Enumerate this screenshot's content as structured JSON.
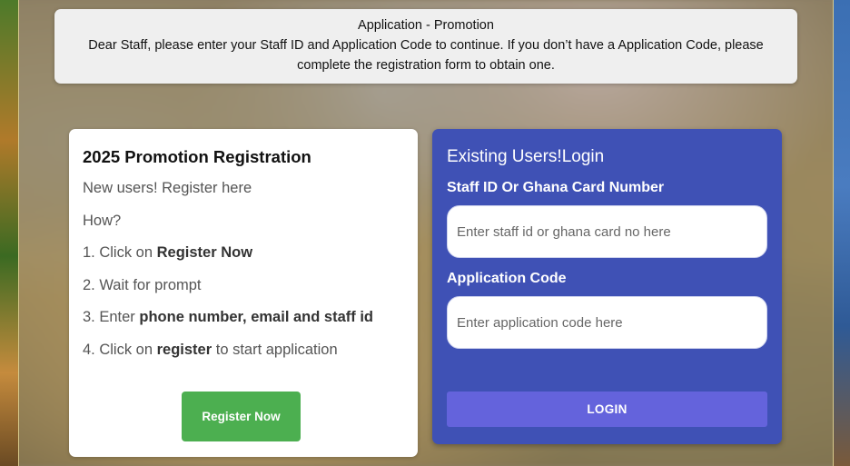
{
  "banner": {
    "title": "Application - Promotion",
    "message": "Dear Staff, please enter your Staff ID and Application Code to continue. If you don’t have a Application Code, please complete the registration form to obtain one."
  },
  "register": {
    "heading": "2025 Promotion Registration",
    "intro": "New users! Register here",
    "how": "How?",
    "steps": [
      {
        "before": "1. Click on ",
        "bold": "Register Now",
        "after": ""
      },
      {
        "before": "2. Wait for prompt",
        "bold": "",
        "after": ""
      },
      {
        "before": "3. Enter ",
        "bold": "phone number, email and staff id",
        "after": ""
      },
      {
        "before": "4. Click on ",
        "bold": "register",
        "after": " to start application"
      }
    ],
    "button_label": "Register Now"
  },
  "login": {
    "heading": "Existing Users!Login",
    "staff_label": "Staff ID Or Ghana Card Number",
    "staff_placeholder": "Enter staff id or ghana card no here",
    "staff_value": "",
    "code_label": "Application Code",
    "code_placeholder": "Enter application code here",
    "code_value": "",
    "button_label": "LOGIN"
  },
  "colors": {
    "login_panel": "#3f51b5",
    "login_button": "#6463dc",
    "register_button": "#4caf50"
  }
}
